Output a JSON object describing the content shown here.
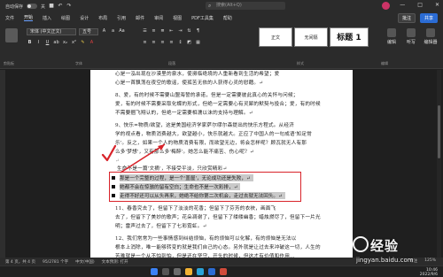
{
  "titlebar": {
    "autosave_label": "自动保存",
    "autosave_state": "关",
    "doc_title": "文档1 - Word",
    "search_placeholder": "搜索(Alt+Q)"
  },
  "menu": {
    "tabs": [
      "文件",
      "开始",
      "插入",
      "绘图",
      "设计",
      "布局",
      "引用",
      "邮件",
      "审阅",
      "视图",
      "PDF工具集",
      "帮助"
    ],
    "active_index": 1,
    "comment_label": "批注",
    "share_label": "共享"
  },
  "ribbon": {
    "font_name": "宋体 (中文正文)",
    "font_size": "五号",
    "styles": [
      "正文",
      "无间隔",
      "标题 1"
    ],
    "group_labels": [
      "剪贴板",
      "字体",
      "段落",
      "样式",
      "编辑"
    ],
    "right_buttons": [
      "编辑",
      "听写",
      "编辑器"
    ]
  },
  "document": {
    "paragraphs": [
      "心是一泓出现在沙漠里的泉水，使濒临绝境的人重新看到生活的希望；爱",
      "心是一首飘荡在夜空的歌谣，使孤苦无依的人获得心灵的慰藉。↵",
      "8、爱，有的时候不需要山盟海誓的承诺，但是一定需要彼此真心的关怀与问候；",
      "爱，有的时候不需要采取化蝶的形式，但绝一定需要心有灵犀的默契与投合；爱，有的时候",
      "不需要捆飞翔认的，但绝一定需要相濡以沫的支持与理解。↵",
      "9、快乐=物质/欲望，这是美国经济学家萨尔缪尔森提出的快乐方程式。从经济",
      "学的视点看，物质消费越大，欲望越小，快乐就越大。正应了中国人的一句成语'知足常",
      "乐'。反之，如果一个人的物质消费有限，而欲望无边，将会怎样呢？顾瓦就无人有那",
      "么多'梦想'，又有那么多'梅醉'。她怎么能不痛苦、伤心呢？↵",
      "↵",
      "生命不是一篇'文摘'，不接受平淡，只欣赏精彩↵",
      "11、春香究去了，但留下了淡淡的花香；但留下了芬芳的衣袂，画面飞",
      "去了，但留下了美妙的歌声；花朵凋谢了，但留下了缕缕幽香；蜡烛燃尽了，但留下一片光",
      "明；雷声过去了，但留下了七彩霓虹。↵",
      "12、我们常常为一些事情感到纠结烦恼，有的烦恼可以化解，有的烦恼是无法以",
      "根本上消除，唯一能够转变的就是我们自己的心态。另外就是让过去来冲破这一切，人生的",
      "苦难就是一个从不怕到怕，但是还在坚守，开头的时候，但这才有价值和作用…"
    ],
    "bullets": [
      "那是一个完整的过程，是一个'盖屋'，无论成功还是失败，↵",
      "她都不会在惊骇的留有空白；生命也不是一次彩排，↵",
      "走得不好还可以从头再来，她绝不给你第二次机会，走过去就无法回头。↵"
    ]
  },
  "status": {
    "page": "第 4 页，共 4 页",
    "words": "95/2781 个字",
    "lang": "中文(中国)",
    "mode": "文本预测: 打开",
    "focus": "专注",
    "zoom": "125%"
  },
  "taskbar": {
    "time": "10:46",
    "date": "2022/9/6"
  },
  "watermark": {
    "brand": "经验",
    "url": "jingyan.baidu.com"
  }
}
